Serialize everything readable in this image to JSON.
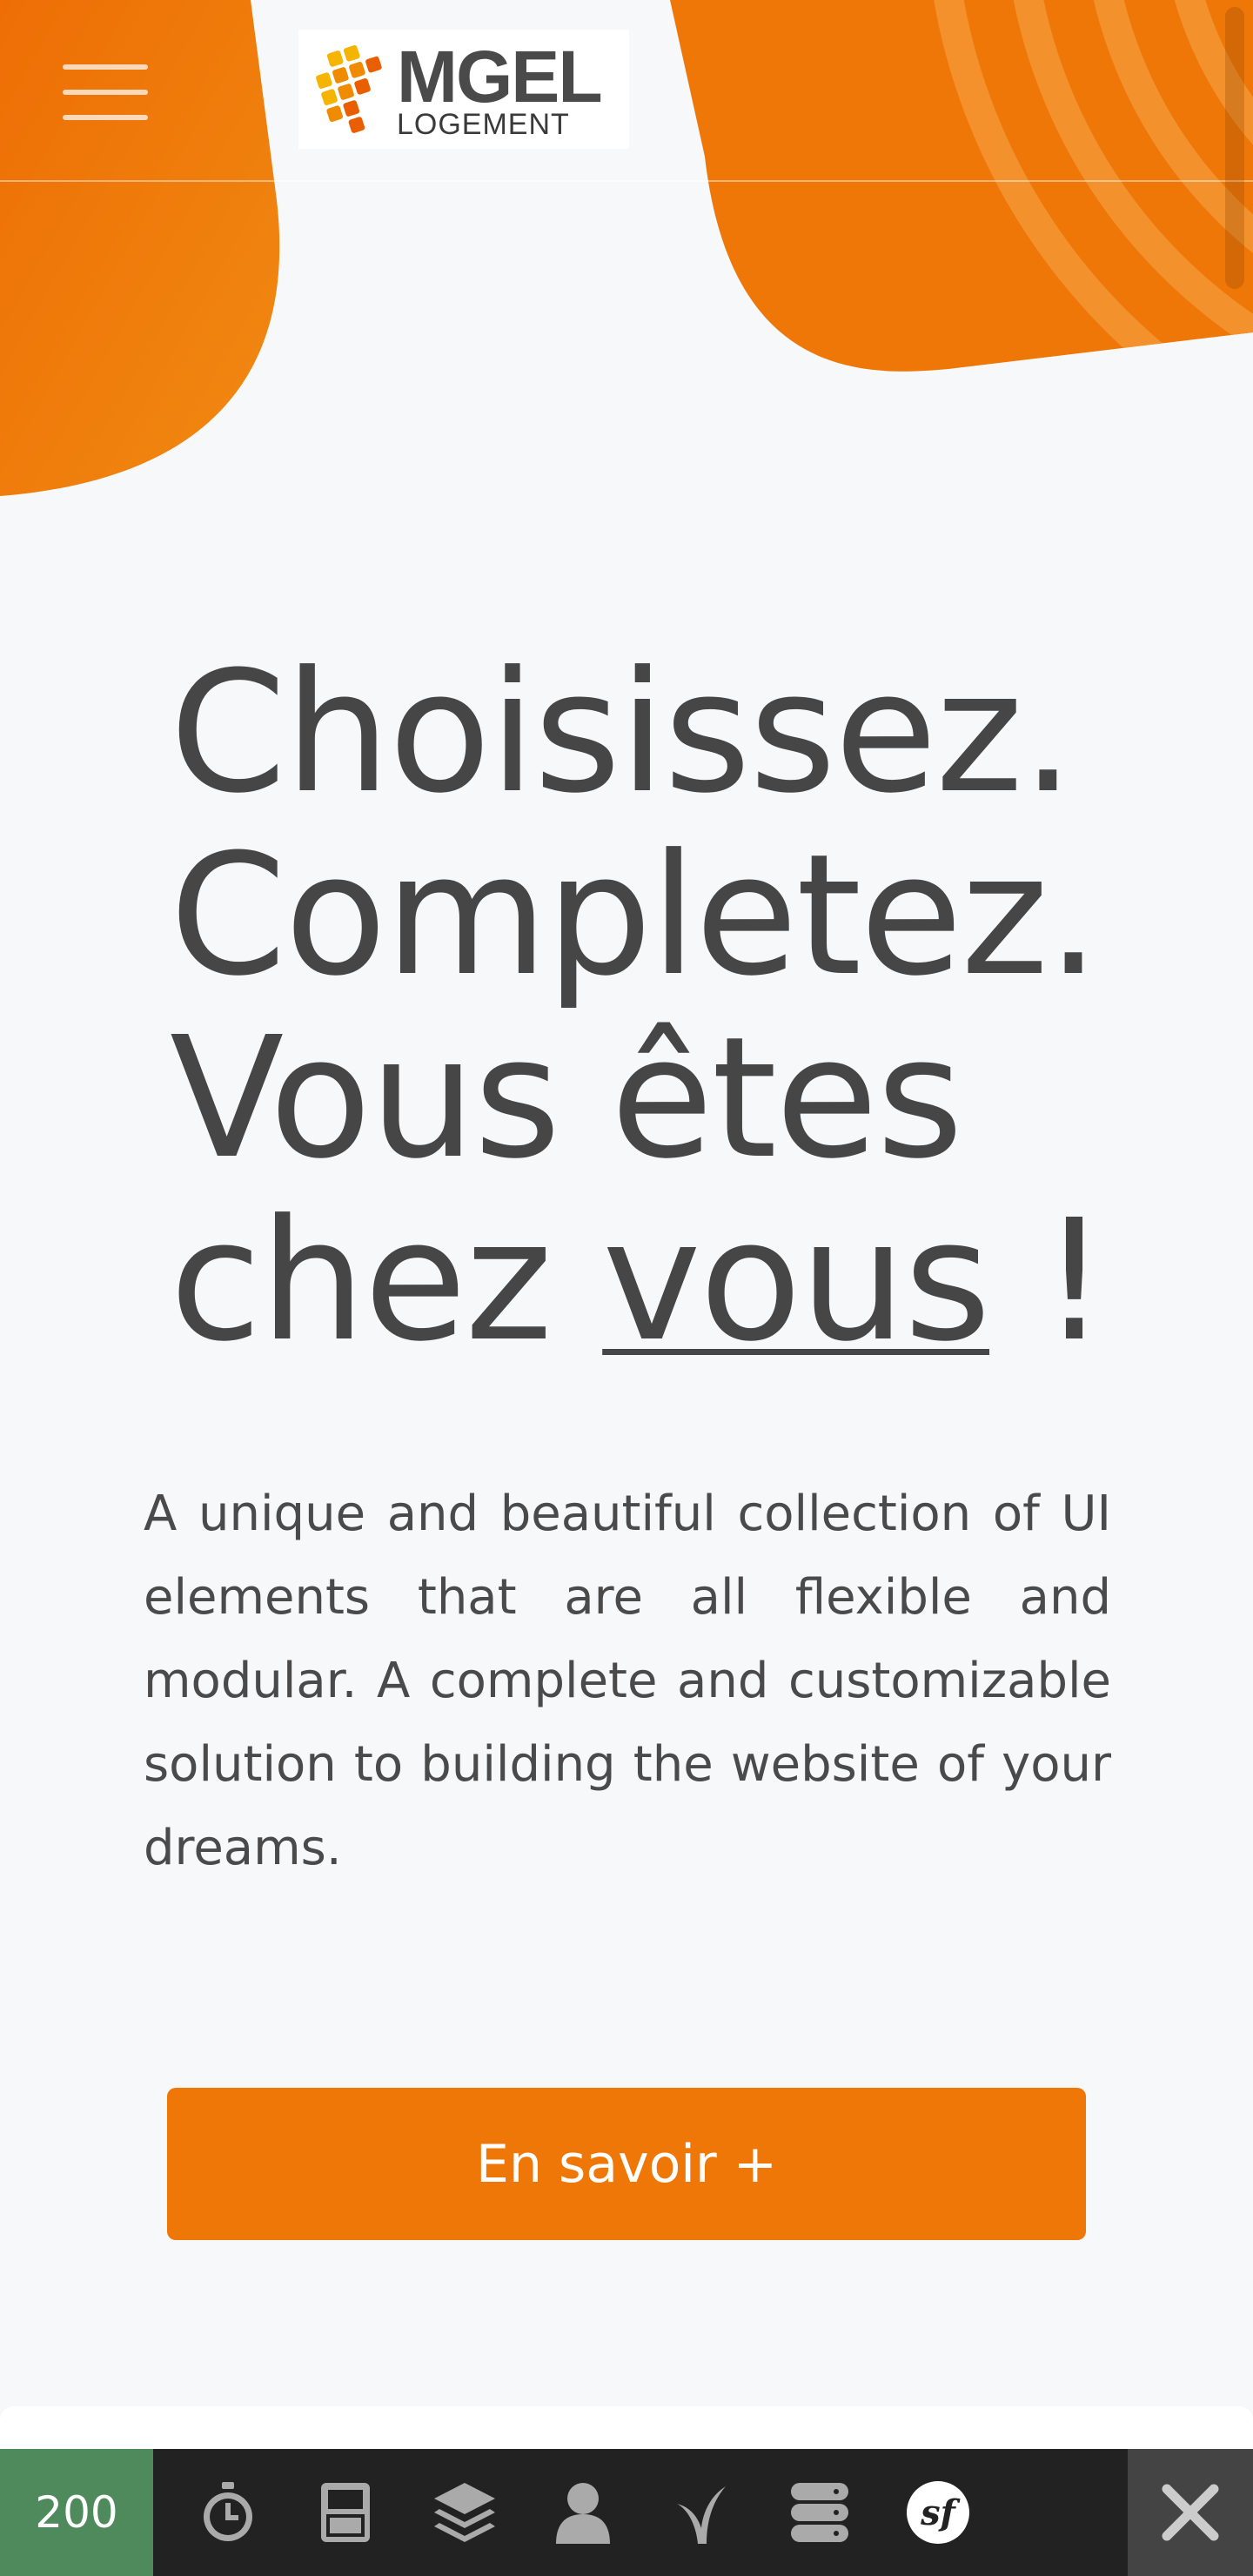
{
  "brand": {
    "logo_main": "MGEL",
    "logo_sub": "LOGEMENT",
    "accent_color": "#ee7708",
    "logo_tile_colors": [
      "#f5b400",
      "#f08a00",
      "#e95f00"
    ]
  },
  "header": {
    "menu_icon": "hamburger-menu-icon"
  },
  "hero": {
    "title_lines": [
      "Choisissez.",
      "Completez.",
      "Vous êtes",
      "chez "
    ],
    "title_emphasis": "vous",
    "title_suffix": " !",
    "description": "A unique and beautiful collection of UI elements that are all flexible and modular. A complete and customizable solution to building the website of your dreams.",
    "cta_label": "En savoir +"
  },
  "debug_toolbar": {
    "status_code": "200",
    "icons": [
      "timer-icon",
      "memory-icon",
      "layers-icon",
      "user-icon",
      "twig-icon",
      "database-icon",
      "symfony-icon",
      "close-icon"
    ]
  }
}
